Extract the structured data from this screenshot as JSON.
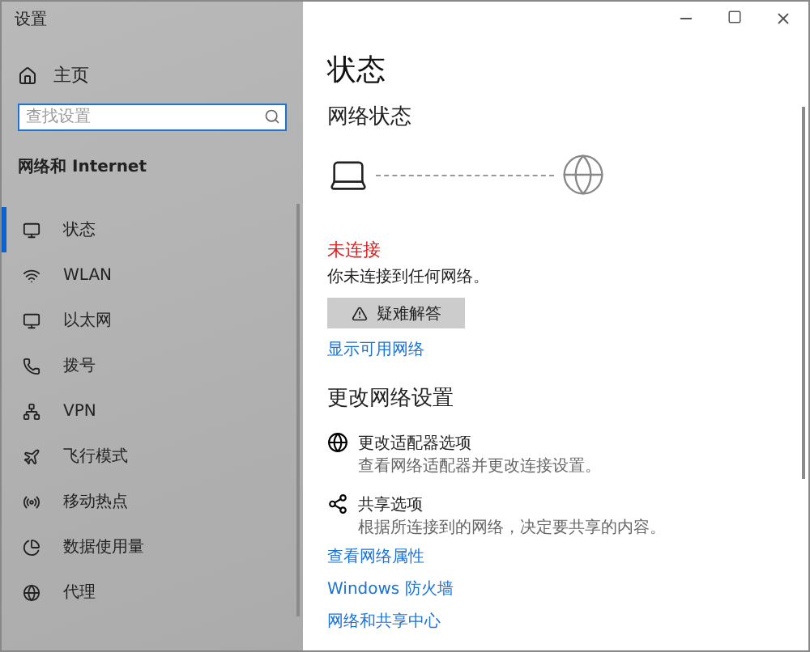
{
  "window": {
    "title": "设置"
  },
  "sidebar": {
    "home": "主页",
    "search": {
      "placeholder": "查找设置"
    },
    "section": "网络和 Internet",
    "items": [
      {
        "label": "状态",
        "selected": true
      },
      {
        "label": "WLAN",
        "selected": false
      },
      {
        "label": "以太网",
        "selected": false
      },
      {
        "label": "拨号",
        "selected": false
      },
      {
        "label": "VPN",
        "selected": false
      },
      {
        "label": "飞行模式",
        "selected": false
      },
      {
        "label": "移动热点",
        "selected": false
      },
      {
        "label": "数据使用量",
        "selected": false
      },
      {
        "label": "代理",
        "selected": false
      }
    ]
  },
  "main": {
    "title": "状态",
    "network_status": {
      "heading": "网络状态",
      "state": "未连接",
      "message": "你未连接到任何网络。",
      "troubleshoot": "疑难解答",
      "show_networks": "显示可用网络"
    },
    "change_settings": {
      "heading": "更改网络设置",
      "options": [
        {
          "title": "更改适配器选项",
          "description": "查看网络适配器并更改连接设置。"
        },
        {
          "title": "共享选项",
          "description": "根据所连接到的网络，决定要共享的内容。"
        }
      ]
    },
    "links": [
      "查看网络属性",
      "Windows 防火墙",
      "网络和共享中心"
    ]
  }
}
